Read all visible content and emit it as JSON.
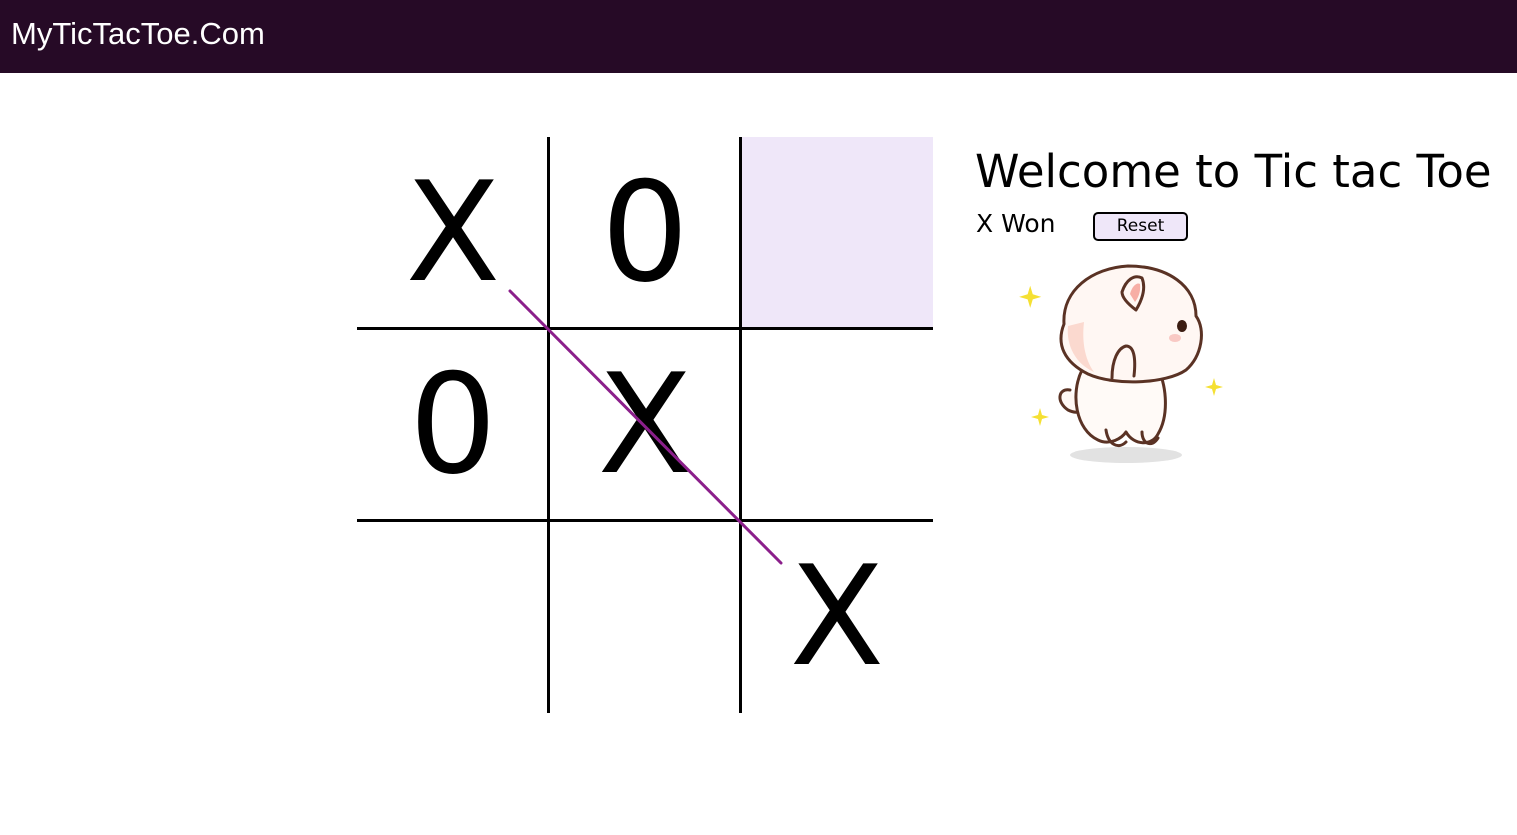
{
  "header": {
    "brand": "MyTicTacToe.Com",
    "background_color": "#260a26"
  },
  "board": {
    "cells": [
      "X",
      "0",
      "",
      "0",
      "X",
      "",
      "",
      "",
      "X"
    ],
    "highlighted_cell": 2,
    "winning_line": [
      0,
      4,
      8
    ],
    "highlight_color": "#efe7f9",
    "win_line_color": "#8b1f8b"
  },
  "panel": {
    "title": "Welcome to Tic tac Toe",
    "status": "X Won",
    "reset_label": "Reset"
  },
  "mascot": {
    "icon": "cat-mascot-icon"
  }
}
